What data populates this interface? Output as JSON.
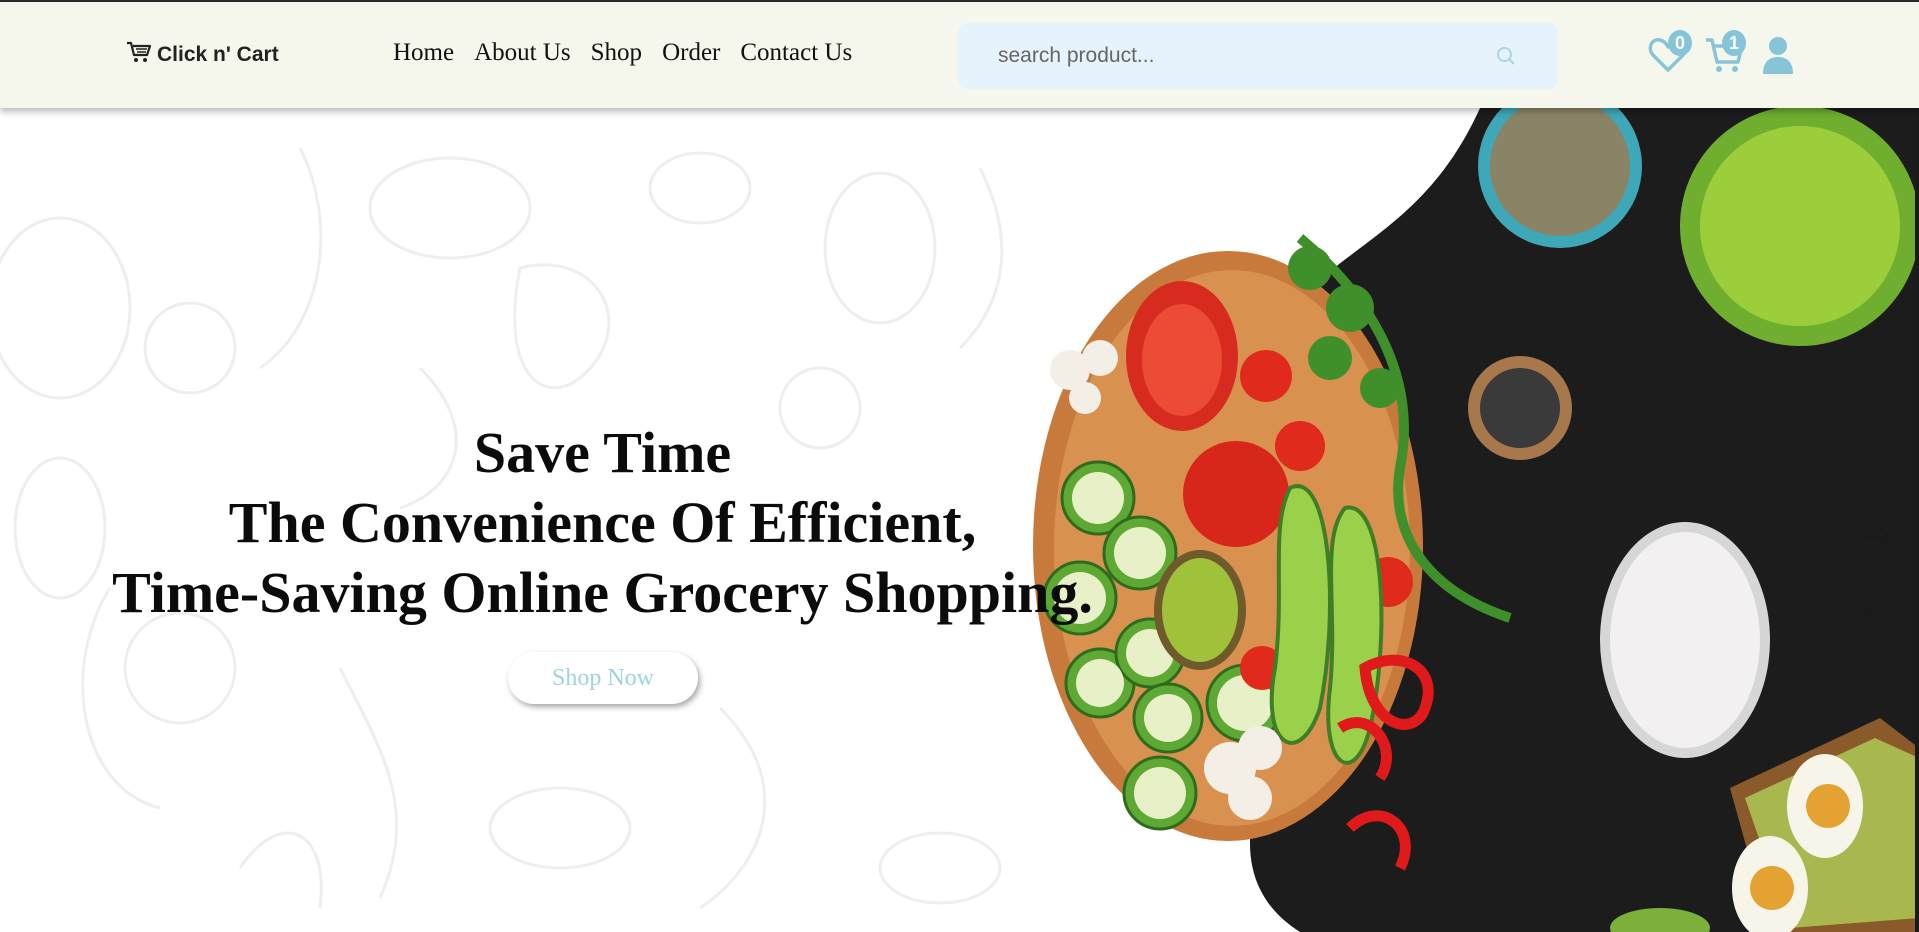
{
  "brand": {
    "name": "Click n' Cart",
    "logo_icon": "cart-icon"
  },
  "nav": {
    "items": [
      {
        "label": "Home"
      },
      {
        "label": "About Us"
      },
      {
        "label": "Shop"
      },
      {
        "label": "Order"
      },
      {
        "label": "Contact Us"
      }
    ]
  },
  "search": {
    "placeholder": "search product...",
    "value": "",
    "icon": "search-icon"
  },
  "header_icons": {
    "wishlist": {
      "icon": "heart-icon",
      "count": "0"
    },
    "cart": {
      "icon": "cart-icon",
      "count": "1"
    },
    "account": {
      "icon": "user-icon"
    }
  },
  "hero": {
    "title_line1": "Save Time",
    "title_line2": "The Convenience Of Efficient,",
    "title_line3": "Time-Saving Online Grocery Shopping.",
    "button_label": "Shop Now",
    "next_icon": "arrow-right-icon",
    "prev_icon": "arrow-left-icon"
  },
  "colors": {
    "header_bg": "#f5f7ec",
    "search_bg": "#e6f3fd",
    "accent": "#87c4d8",
    "dark_surface": "#1c1c1c"
  }
}
